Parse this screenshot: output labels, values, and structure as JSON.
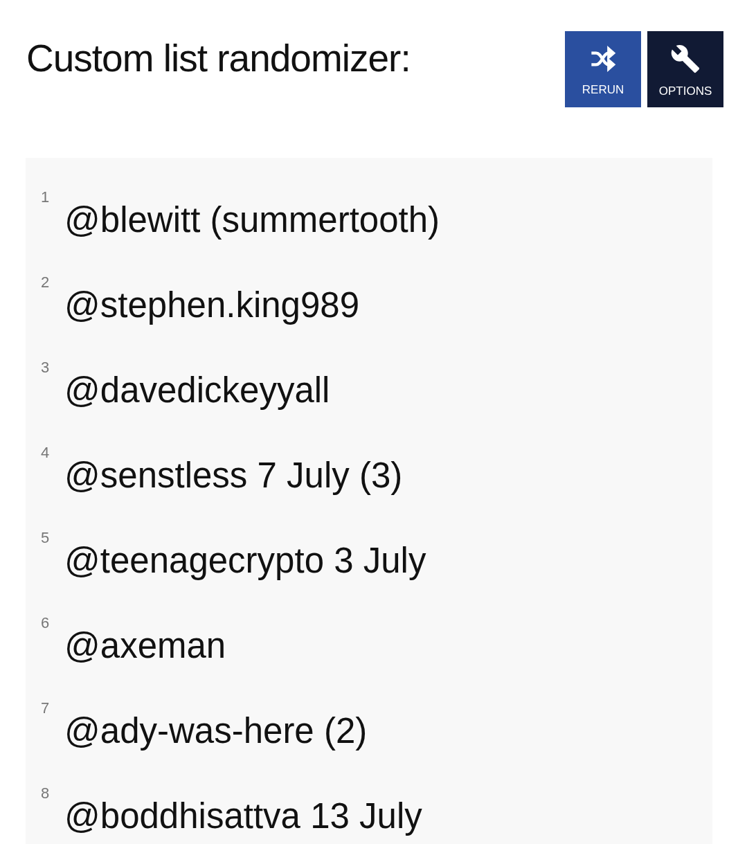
{
  "title": "Custom list randomizer:",
  "buttons": [
    {
      "kind": "rerun",
      "label": "RERUN"
    },
    {
      "kind": "options",
      "label": "OPTIONS"
    }
  ],
  "list": {
    "items": [
      {
        "number": "1",
        "text": "@blewitt (summertooth)"
      },
      {
        "number": "2",
        "text": "@stephen.king989"
      },
      {
        "number": "3",
        "text": "@davedickeyyall"
      },
      {
        "number": "4",
        "text": "@senstless 7 July (3)"
      },
      {
        "number": "5",
        "text": "@teenagecrypto 3 July"
      },
      {
        "number": "6",
        "text": "@axeman"
      },
      {
        "number": "7",
        "text": "@ady-was-here (2)"
      },
      {
        "number": "8",
        "text": "@boddhisattva 13 July"
      }
    ]
  }
}
